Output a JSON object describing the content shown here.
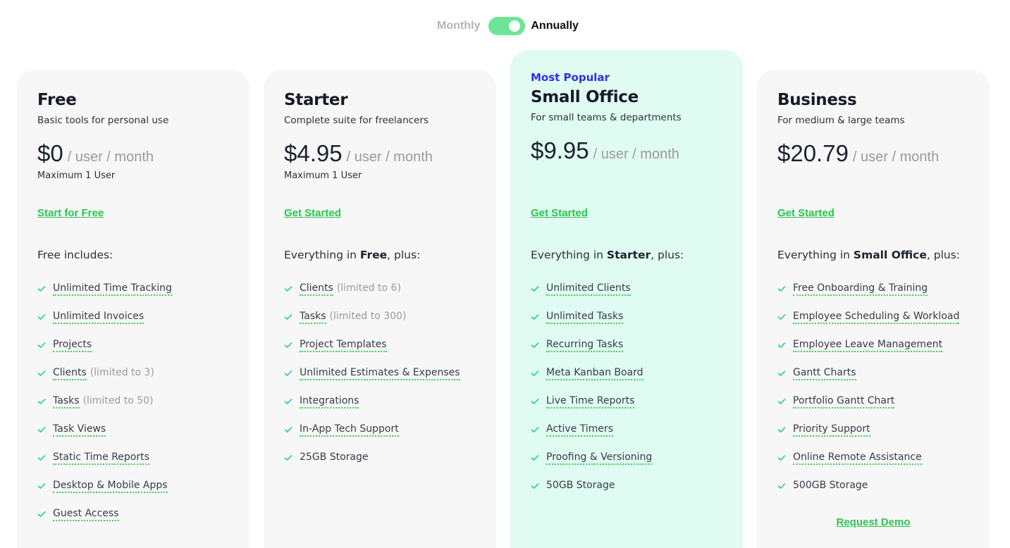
{
  "billing_toggle": {
    "monthly_label": "Monthly",
    "annually_label": "Annually",
    "selected": "Annually"
  },
  "colors": {
    "accent_green": "#29c64d",
    "toggle_green": "#6ee596",
    "popular_bg": "#e0fbf1",
    "card_bg": "#f7f7f7",
    "badge_blue": "#2f2ee6",
    "check_teal": "#1ec6a8"
  },
  "plans": [
    {
      "name": "Free",
      "description": "Basic tools for personal use",
      "price": "$0",
      "per": "/ user / month",
      "max_users": "Maximum 1 User",
      "cta": "Start for Free",
      "includes_prefix": "Free includes:",
      "features": [
        {
          "label": "Unlimited Time Tracking",
          "note": ""
        },
        {
          "label": "Unlimited Invoices",
          "note": ""
        },
        {
          "label": "Projects",
          "note": ""
        },
        {
          "label": "Clients",
          "note": "(limited to 3)"
        },
        {
          "label": "Tasks",
          "note": "(limited to 50)"
        },
        {
          "label": "Task Views",
          "note": ""
        },
        {
          "label": "Static Time Reports",
          "note": ""
        },
        {
          "label": "Desktop & Mobile Apps",
          "note": ""
        },
        {
          "label": "Guest Access",
          "note": ""
        }
      ]
    },
    {
      "name": "Starter",
      "description": "Complete suite for freelancers",
      "price": "$4.95",
      "per": "/ user / month",
      "max_users": "Maximum 1 User",
      "cta": "Get Started",
      "includes_prefix": "Everything in ",
      "includes_bold": "Free",
      "includes_suffix": ", plus:",
      "features": [
        {
          "label": "Clients",
          "note": "(limited to 6)"
        },
        {
          "label": "Tasks",
          "note": "(limited to 300)"
        },
        {
          "label": "Project Templates",
          "note": ""
        },
        {
          "label": "Unlimited Estimates & Expenses",
          "note": ""
        },
        {
          "label": "Integrations",
          "note": ""
        },
        {
          "label": "In-App Tech Support",
          "note": ""
        },
        {
          "label": "25GB Storage",
          "note": "",
          "plain": true
        }
      ]
    },
    {
      "badge": "Most Popular",
      "name": "Small Office",
      "description": "For small teams & departments",
      "price": "$9.95",
      "per": "/ user / month",
      "cta": "Get Started",
      "includes_prefix": "Everything in ",
      "includes_bold": "Starter",
      "includes_suffix": ", plus:",
      "features": [
        {
          "label": "Unlimited Clients",
          "note": ""
        },
        {
          "label": "Unlimited Tasks",
          "note": ""
        },
        {
          "label": "Recurring Tasks",
          "note": ""
        },
        {
          "label": "Meta Kanban Board",
          "note": ""
        },
        {
          "label": "Live Time Reports",
          "note": ""
        },
        {
          "label": "Active Timers",
          "note": ""
        },
        {
          "label": "Proofing & Versioning",
          "note": ""
        },
        {
          "label": "50GB Storage",
          "note": "",
          "plain": true
        }
      ]
    },
    {
      "name": "Business",
      "description": "For medium & large teams",
      "price": "$20.79",
      "per": "/ user / month",
      "cta": "Get Started",
      "includes_prefix": "Everything in ",
      "includes_bold": "Small Office",
      "includes_suffix": ", plus:",
      "features": [
        {
          "label": "Free Onboarding & Training",
          "note": ""
        },
        {
          "label": "Employee Scheduling & Workload",
          "note": ""
        },
        {
          "label": "Employee Leave Management",
          "note": ""
        },
        {
          "label": "Gantt Charts",
          "note": ""
        },
        {
          "label": "Portfolio Gantt Chart",
          "note": ""
        },
        {
          "label": "Priority Support",
          "note": ""
        },
        {
          "label": "Online Remote Assistance",
          "note": ""
        },
        {
          "label": "500GB Storage",
          "note": "",
          "plain": true
        }
      ],
      "secondary_cta": "Request Demo"
    }
  ]
}
